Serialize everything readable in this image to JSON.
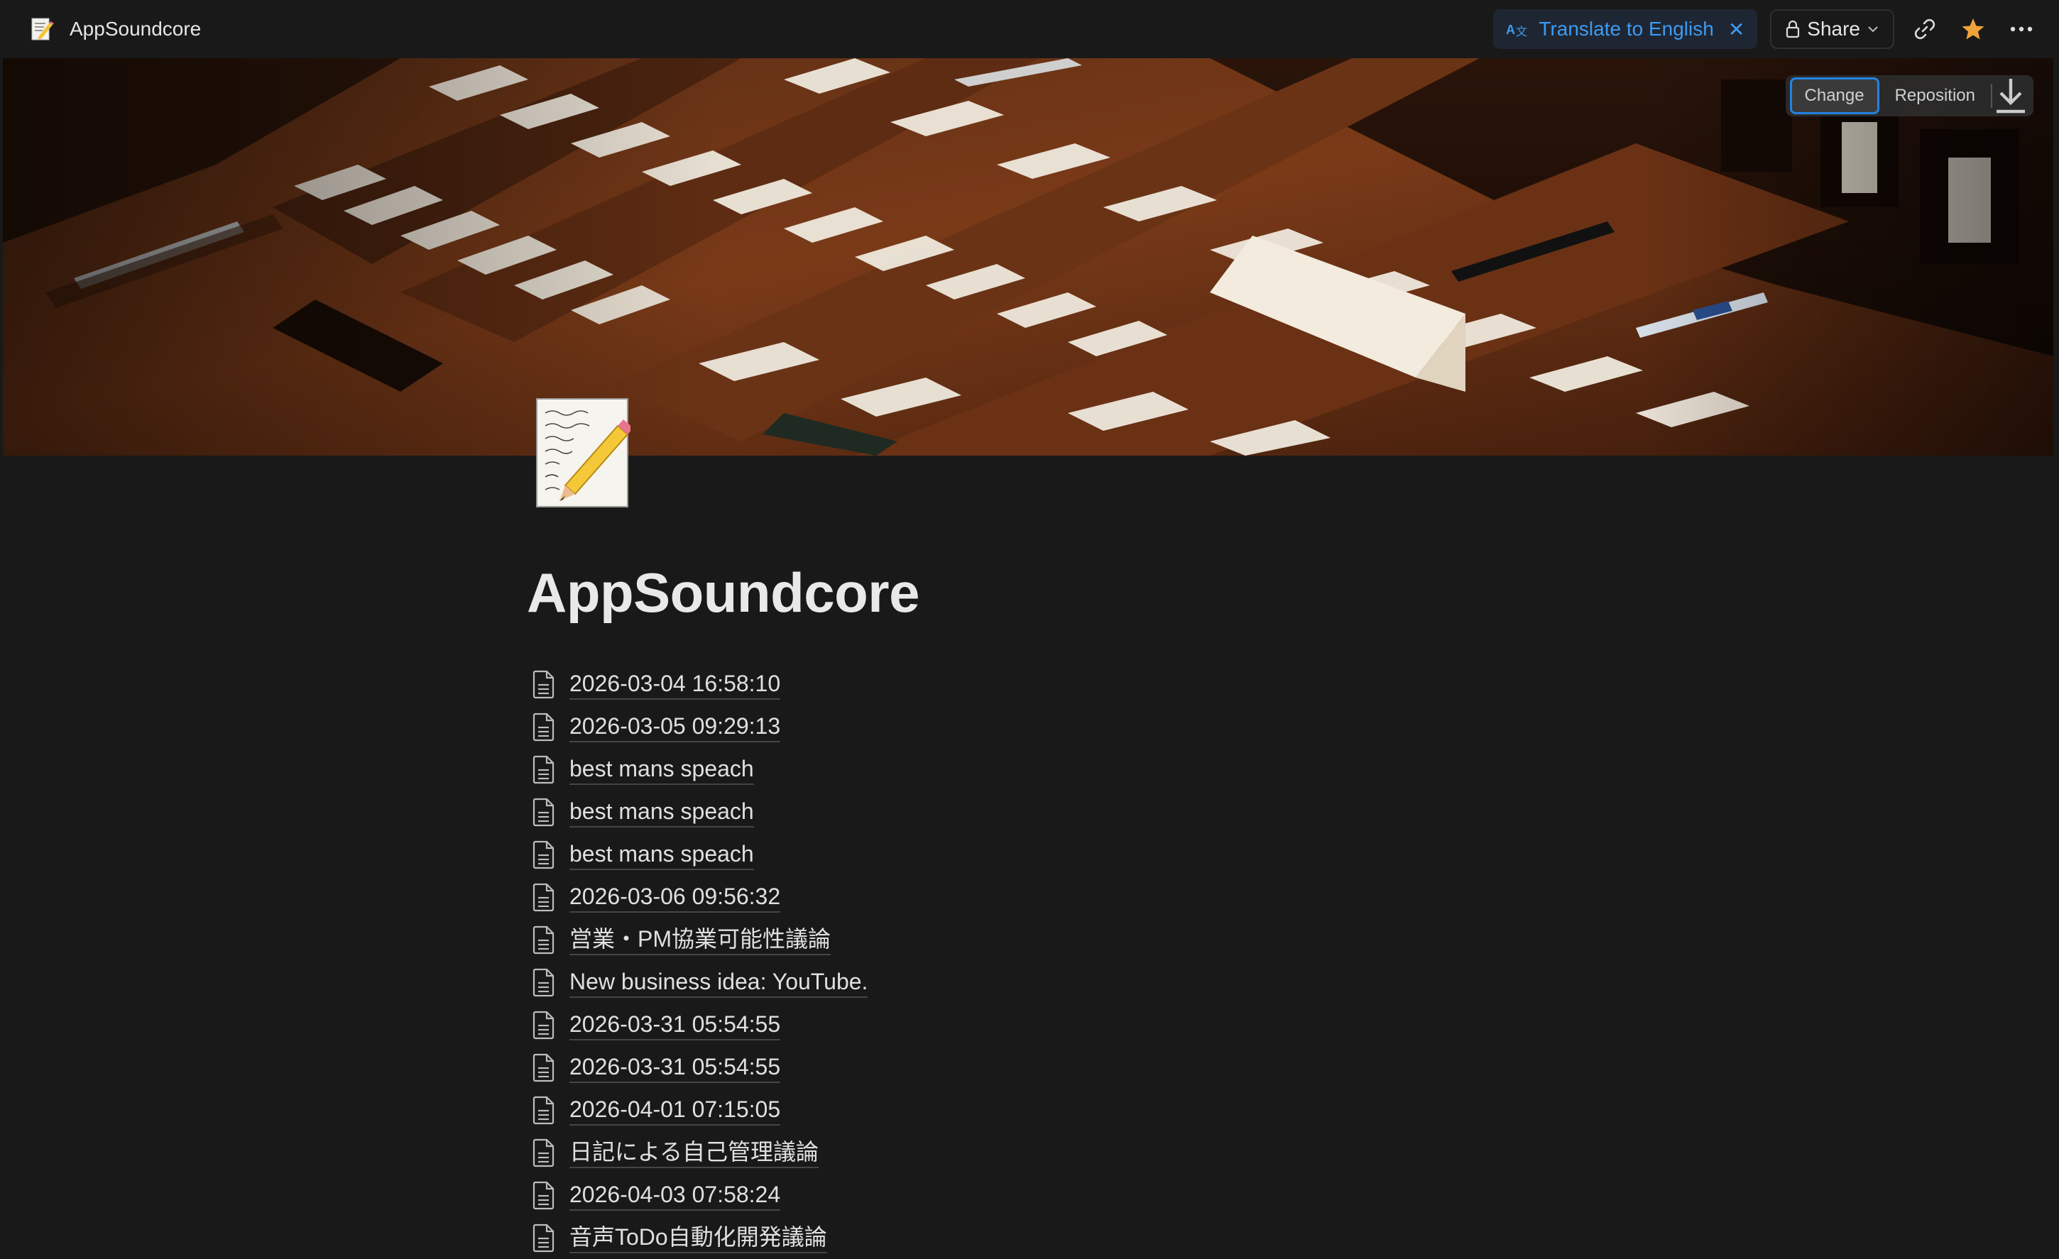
{
  "topbar": {
    "title": "AppSoundcore",
    "translate_label": "Translate to English",
    "share_label": "Share",
    "icons": [
      "page-emoji-icon",
      "translate-icon",
      "close-icon",
      "lock-icon",
      "chevron-down-icon",
      "link-icon",
      "star-icon",
      "more-icon"
    ]
  },
  "cover": {
    "change_label": "Change",
    "reposition_label": "Reposition"
  },
  "page": {
    "title": "AppSoundcore",
    "subpages": [
      "2026-03-04 16:58:10",
      "2026-03-05 09:29:13",
      "best mans speach",
      "best mans speach",
      "best mans speach",
      "2026-03-06 09:56:32",
      "営業・PM協業可能性議論",
      "New business idea: YouTube.",
      "2026-03-31 05:54:55",
      "2026-03-31 05:54:55",
      "2026-04-01 07:15:05",
      "日記による自己管理議論",
      "2026-04-03 07:58:24",
      "音声ToDo自動化開発議論"
    ]
  },
  "colors": {
    "background": "#191919",
    "accent_blue": "#2383e2",
    "translate_text": "#3d9bf2",
    "star": "#f0a23a"
  }
}
